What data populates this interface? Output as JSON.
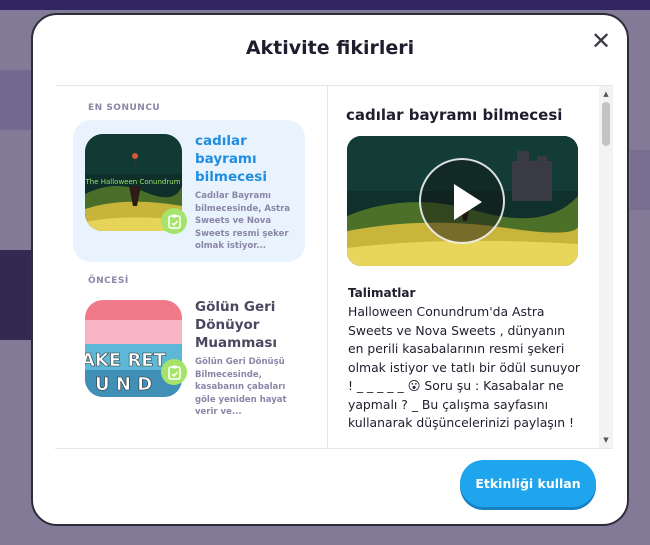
{
  "modal": {
    "title": "Aktivite fikirleri",
    "close_icon": "close-icon"
  },
  "list": {
    "latest_label": "EN SONUNCU",
    "previous_label": "ÖNCESİ",
    "items": [
      {
        "title": "cadılar bayramı bilmecesi",
        "description": "Cadılar Bayramı bilmecesinde, Astra Sweets ve Nova Sweets resmi şeker olmak istiyor...",
        "thumb_caption": "The Halloween Conundrum",
        "selected": true,
        "title_color": "#1f8de0"
      },
      {
        "title": "Gölün Geri Dönüyor Muamması",
        "description": "Gölün Geri Dönüşü Bilmecesinde, kasabanın çabaları göle yeniden hayat verir ve...",
        "thumb_text_1": "AKE RET",
        "thumb_text_2": "U N D",
        "selected": false,
        "title_color": "#4a4760"
      }
    ]
  },
  "detail": {
    "title": "cadılar bayramı bilmecesi",
    "instructions_heading": "Talimatlar",
    "instructions_text": "Halloween Conundrum'da Astra Sweets ve Nova Sweets , dünyanın en perili kasabalarının resmi şekeri olmak istiyor ve tatlı bir ödül sunuyor ! _ _ _ _ _ 😮 Soru şu : Kasabalar ne yapmalı ? _ Bu çalışma sayfasını kullanarak düşüncelerinizi paylaşın !"
  },
  "footer": {
    "use_button_label": "Etkinliği kullan"
  },
  "colors": {
    "accent": "#1fa4ee",
    "badge": "#a5e36b",
    "selected_card_bg": "#e8f3fd"
  }
}
